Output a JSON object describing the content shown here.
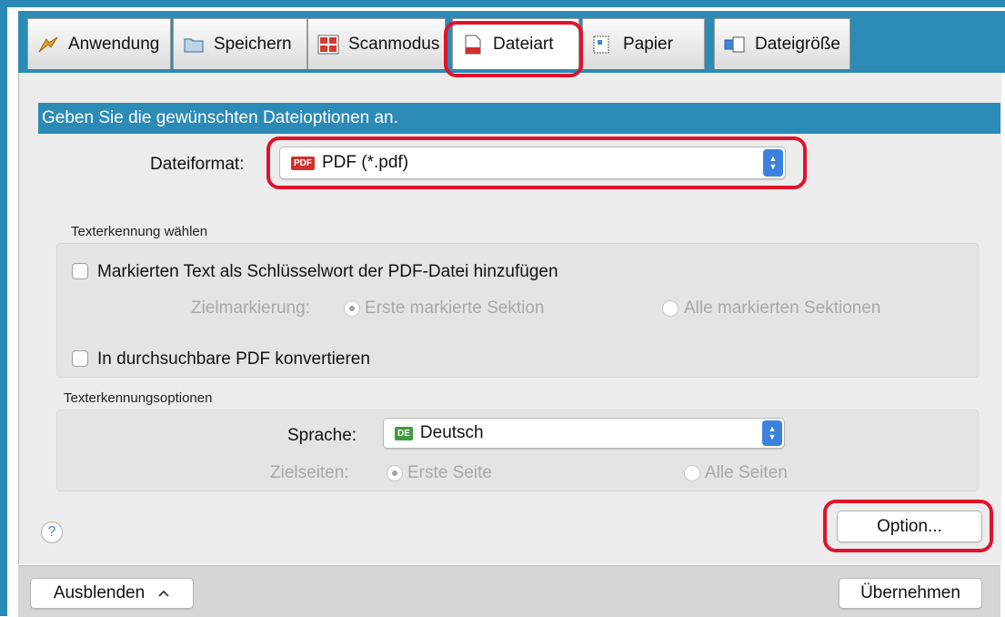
{
  "tabs": [
    {
      "label": "Anwendung",
      "icon": "application-icon"
    },
    {
      "label": "Speichern",
      "icon": "folder-icon"
    },
    {
      "label": "Scanmodus",
      "icon": "scan-mode-icon"
    },
    {
      "label": "Dateiart",
      "icon": "file-type-icon",
      "active": true
    },
    {
      "label": "Papier",
      "icon": "paper-icon"
    },
    {
      "label": "Dateigröße",
      "icon": "file-size-icon"
    }
  ],
  "banner": "Geben Sie die gewünschten Dateioptionen an.",
  "file_format": {
    "label": "Dateiformat:",
    "badge": "PDF",
    "value": "PDF (*.pdf)"
  },
  "text_recognition": {
    "title": "Texterkennung wählen",
    "keyword_checkbox": "Markierten Text als Schlüsselwort der PDF-Datei hinzufügen",
    "target_label": "Zielmarkierung:",
    "target_option_1": "Erste markierte Sektion",
    "target_option_2": "Alle markierten Sektionen",
    "searchable_checkbox": "In durchsuchbare PDF konvertieren"
  },
  "ocr_options": {
    "title": "Texterkennungsoptionen",
    "language_label": "Sprache:",
    "language_badge": "DE",
    "language_value": "Deutsch",
    "pages_label": "Zielseiten:",
    "pages_option_1": "Erste Seite",
    "pages_option_2": "Alle Seiten"
  },
  "buttons": {
    "option": "Option...",
    "hide": "Ausblenden",
    "apply": "Übernehmen",
    "help": "?"
  },
  "colors": {
    "accent": "#2c8ab6",
    "callout": "#e0132b",
    "pdf_badge": "#d0322b",
    "de_badge": "#3f9b3f",
    "stepper": "#3b82e0"
  }
}
